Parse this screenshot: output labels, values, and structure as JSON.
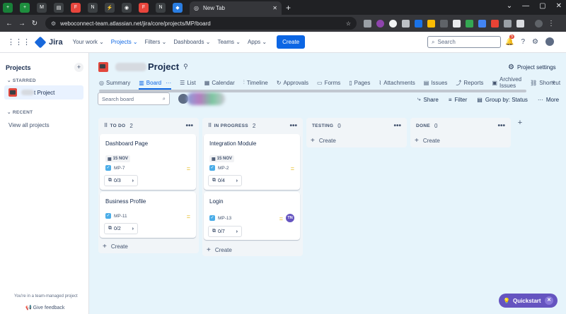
{
  "browser": {
    "tab_title": "New Tab",
    "url": "weboconnect-team.atlassian.net/jira/core/projects/MP/board",
    "pinned_tab_colors": [
      "#188038",
      "#1e8e3e",
      "#3c4043",
      "#e8453c",
      "#3c4043",
      "#e8453c",
      "#3c4043",
      "#3c4043",
      "#e8453c",
      "#2a7de1"
    ]
  },
  "header": {
    "app_name": "Jira",
    "nav": [
      "Your work",
      "Projects",
      "Filters",
      "Dashboards",
      "Teams",
      "Apps"
    ],
    "create_label": "Create",
    "search_placeholder": "Search",
    "notification_count": "5"
  },
  "sidebar": {
    "title": "Projects",
    "starred_label": "STARRED",
    "starred_project": "t Project",
    "recent_label": "RECENT",
    "view_all": "View all projects",
    "footer_text": "You're in a team-managed project",
    "feedback": "Give feedback"
  },
  "project": {
    "title": "Project",
    "settings_label": "Project settings",
    "tabs": [
      "Summary",
      "Board",
      "List",
      "Calendar",
      "Timeline",
      "Approvals",
      "Forms",
      "Pages",
      "Attachments",
      "Issues",
      "Reports",
      "Archived Issues",
      "Shortcut"
    ]
  },
  "toolbar": {
    "search_placeholder": "Search board",
    "share": "Share",
    "filter": "Filter",
    "group_by": "Group by: Status",
    "more": "More"
  },
  "board": {
    "columns": [
      {
        "name": "TO DO",
        "count": "2",
        "cards": [
          {
            "title": "Dashboard Page",
            "date": "15 NOV",
            "key": "MP-7",
            "subtasks": "0/3"
          },
          {
            "title": "Business Profile",
            "key": "MP-11",
            "subtasks": "0/2"
          }
        ],
        "create_label": "Create"
      },
      {
        "name": "IN PROGRESS",
        "count": "2",
        "cards": [
          {
            "title": "Integration Module",
            "date": "15 NOV",
            "key": "MP-2",
            "subtasks": "0/4"
          },
          {
            "title": "Login",
            "key": "MP-13",
            "subtasks": "0/7",
            "assignee": "TN"
          }
        ],
        "create_label": "Create"
      },
      {
        "name": "TESTING",
        "count": "0",
        "create_label": "Create"
      },
      {
        "name": "DONE",
        "count": "0",
        "create_label": "Create"
      }
    ]
  },
  "quickstart": {
    "label": "Quickstart"
  }
}
